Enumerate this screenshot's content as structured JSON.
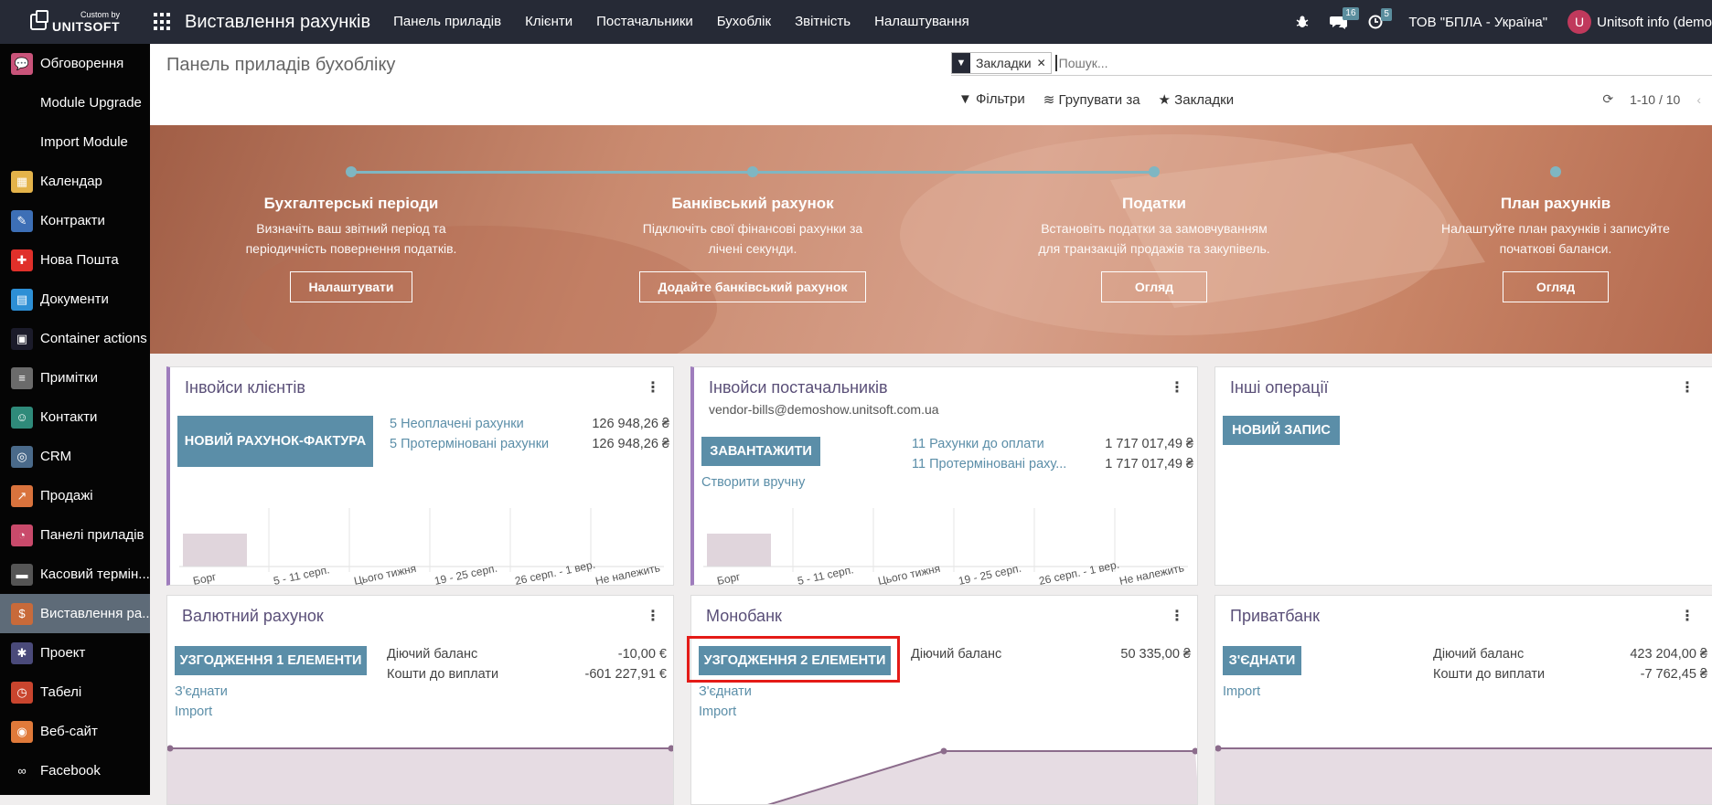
{
  "topbar": {
    "logo_small": "Custom by",
    "logo_big": "UNITSOFT",
    "app_title": "Виставлення рахунків",
    "nav": [
      "Панель приладів",
      "Клієнти",
      "Постачальники",
      "Бухоблік",
      "Звітність",
      "Налаштування"
    ],
    "messages_count": "16",
    "activities_count": "5",
    "company": "ТОВ \"БПЛА - Україна\"",
    "avatar_letter": "U",
    "user": "Unitsoft info (demo"
  },
  "sidebar": {
    "items": [
      {
        "label": "Обговорення",
        "icon": "chat-icon",
        "color": "#c9547a",
        "glyph": "💬"
      },
      {
        "label": "Module Upgrade",
        "icon": "",
        "color": "",
        "glyph": ""
      },
      {
        "label": "Import Module",
        "icon": "",
        "color": "",
        "glyph": ""
      },
      {
        "label": "Календар",
        "icon": "calendar-icon",
        "color": "#e4b34a",
        "glyph": "▦"
      },
      {
        "label": "Контракти",
        "icon": "contract-icon",
        "color": "#3d6fb6",
        "glyph": "✎"
      },
      {
        "label": "Нова Пошта",
        "icon": "nova-poshta-icon",
        "color": "#e0302a",
        "glyph": "✚"
      },
      {
        "label": "Документи",
        "icon": "documents-icon",
        "color": "#2d8fd5",
        "glyph": "▤"
      },
      {
        "label": "Container actions",
        "icon": "container-icon",
        "color": "#1b1b2a",
        "glyph": "▣"
      },
      {
        "label": "Примітки",
        "icon": "notes-icon",
        "color": "#6b6b6b",
        "glyph": "≡"
      },
      {
        "label": "Контакти",
        "icon": "contacts-icon",
        "color": "#2f8a7a",
        "glyph": "☺"
      },
      {
        "label": "CRM",
        "icon": "crm-icon",
        "color": "#4a6a8a",
        "glyph": "◎"
      },
      {
        "label": "Продажі",
        "icon": "sales-icon",
        "color": "#d9733d",
        "glyph": "↗"
      },
      {
        "label": "Панелі приладів",
        "icon": "dashboard-icon",
        "color": "#c94a6b",
        "glyph": "◔"
      },
      {
        "label": "Касовий термін...",
        "icon": "pos-icon",
        "color": "#555555",
        "glyph": "▬"
      },
      {
        "label": "Виставлення ра...",
        "icon": "invoicing-icon",
        "color": "#c86a3a",
        "glyph": "$"
      },
      {
        "label": "Проект",
        "icon": "project-icon",
        "color": "#4a4a7a",
        "glyph": "✱"
      },
      {
        "label": "Табелі",
        "icon": "timesheet-icon",
        "color": "#c9452e",
        "glyph": "◷"
      },
      {
        "label": "Веб-сайт",
        "icon": "website-icon",
        "color": "#e07a3a",
        "glyph": "◉"
      },
      {
        "label": "Facebook",
        "icon": "facebook-icon",
        "color": "#050505",
        "glyph": "∞"
      }
    ]
  },
  "control": {
    "breadcrumb": "Панель приладів бухобліку",
    "facet_label": "Закладки",
    "search_placeholder": "Пошук...",
    "filters_label": "Фільтри",
    "groupby_label": "Групувати за",
    "favorites_label": "Закладки",
    "pager": "1-10 / 10"
  },
  "banner": {
    "steps": [
      {
        "title": "Бухгалтерські періоди",
        "desc1": "Визначіть ваш звітний період та",
        "desc2": "періодичність повернення податків.",
        "button": "Налаштувати"
      },
      {
        "title": "Банківський рахунок",
        "desc1": "Підключіть свої фінансові рахунки за",
        "desc2": "лічені секунди.",
        "button": "Додайте банківський рахунок"
      },
      {
        "title": "Податки",
        "desc1": "Встановіть податки за замовчуванням",
        "desc2": "для транзакцій продажів та закупівель.",
        "button": "Огляд"
      },
      {
        "title": "План рахунків",
        "desc1": "Налаштуйте план рахунків і записуйте",
        "desc2": "початкові баланси.",
        "button": "Огляд"
      }
    ]
  },
  "cards": {
    "customer_invoices": {
      "title": "Інвойси клієнтів",
      "button": "НОВИЙ РАХУНОК-ФАКТУРА",
      "rows": [
        {
          "label": "5 Неоплачені рахунки",
          "value": "126 948,26 ₴"
        },
        {
          "label": "5 Протерміновані рахунки",
          "value": "126 948,26 ₴"
        }
      ]
    },
    "vendor_bills": {
      "title": "Інвойси постачальників",
      "email": "vendor-bills@demoshow.unitsoft.com.ua",
      "button": "ЗАВАНТАЖИТИ",
      "link": "Створити вручну",
      "rows": [
        {
          "label": "11 Рахунки до оплати",
          "value": "1 717 017,49 ₴"
        },
        {
          "label": "11 Протерміновані раху...",
          "value": "1 717 017,49 ₴"
        }
      ]
    },
    "other": {
      "title": "Інші операції",
      "button": "НОВИЙ ЗАПИС"
    },
    "currency": {
      "title": "Валютний рахунок",
      "button": "УЗГОДЖЕННЯ 1 ЕЛЕМЕНТИ",
      "link1": "З'єднати",
      "link2": "Import",
      "rows": [
        {
          "label": "Діючий баланс",
          "value": "-10,00 €"
        },
        {
          "label": "Кошти до виплати",
          "value": "-601 227,91 €"
        }
      ]
    },
    "monobank": {
      "title": "Монобанк",
      "button": "УЗГОДЖЕННЯ 2 ЕЛЕМЕНТИ",
      "link1": "З'єднати",
      "link2": "Import",
      "rows": [
        {
          "label": "Діючий баланс",
          "value": "50 335,00 ₴"
        }
      ]
    },
    "privatbank": {
      "title": "Приватбанк",
      "button": "З'ЄДНАТИ",
      "link1": "Import",
      "rows": [
        {
          "label": "Діючий баланс",
          "value": "423 204,00 ₴"
        },
        {
          "label": "Кошти до виплати",
          "value": "-7 762,45 ₴"
        }
      ]
    }
  },
  "chart_labels": [
    "Борг",
    "5 - 11 серп.",
    "Цього тижня",
    "19 - 25 серп.",
    "26 серп. - 1 вер.",
    "Не належить"
  ],
  "colors": {
    "topbar": "#262a36",
    "sidebar": "#050505",
    "primary_button": "#5b8ea8",
    "card_title": "#5a4f78",
    "accent_border": "#9f7dbd",
    "highlight": "#e41b17",
    "chart_fill": "#e0d5dc",
    "chart_line": "#8c6c8c"
  }
}
